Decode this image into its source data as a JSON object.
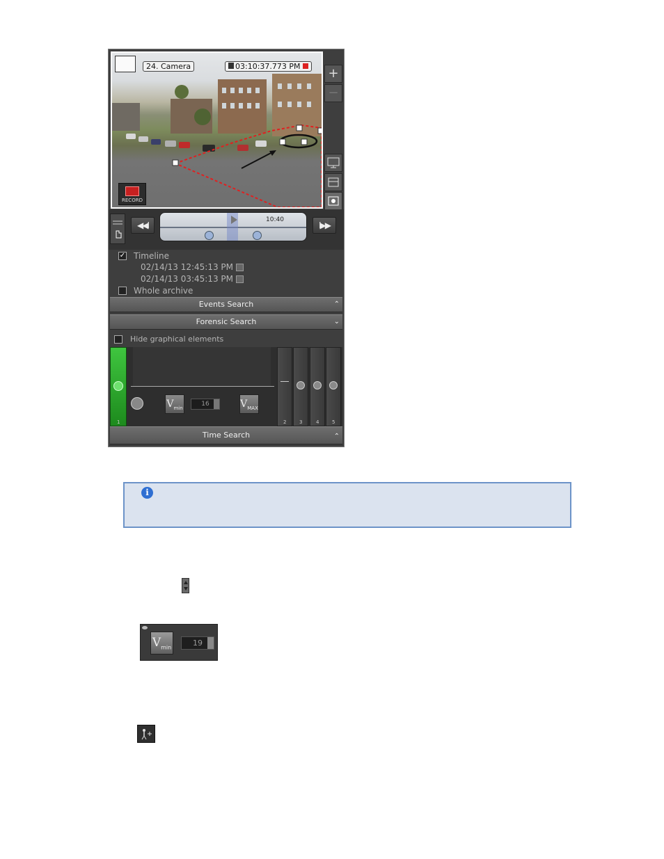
{
  "video": {
    "camera_name": "24. Camera",
    "timestamp": "03:10:37.773 PM",
    "record_label": "RECORD"
  },
  "right_toolbar": {
    "zoom_in": "+",
    "zoom_out": "−"
  },
  "playback": {
    "rewind_label": "◀◀I",
    "forward_label": "I▶▶",
    "timeline_time": "10:40"
  },
  "options": {
    "timeline_label": "Timeline",
    "timeline_checked": true,
    "start_datetime": "02/14/13 12:45:13 PM",
    "end_datetime": "02/14/13 03:45:13 PM",
    "whole_archive_label": "Whole archive",
    "whole_archive_checked": false
  },
  "sections": {
    "events_search": "Events Search",
    "forensic_search": "Forensic Search",
    "time_search": "Time Search"
  },
  "forensic": {
    "hide_graphical_label": "Hide graphical elements",
    "lanes": [
      "1",
      "2",
      "3",
      "4",
      "5"
    ],
    "vmin_label": "V",
    "vmin_sub": "min",
    "vmin_value": "16",
    "vmax_label": "V",
    "vmax_sub": "MAX"
  },
  "sample": {
    "vmin_label": "V",
    "vmin_sub": "min",
    "vmin_value": "19"
  },
  "info": {
    "icon": "i"
  },
  "colors": {
    "panel_bg": "#3e3e3e",
    "active_lane": "#2fa82f",
    "info_bg": "#dbe3ef",
    "info_border": "#6c93c8",
    "zone_outline": "#e02020"
  }
}
